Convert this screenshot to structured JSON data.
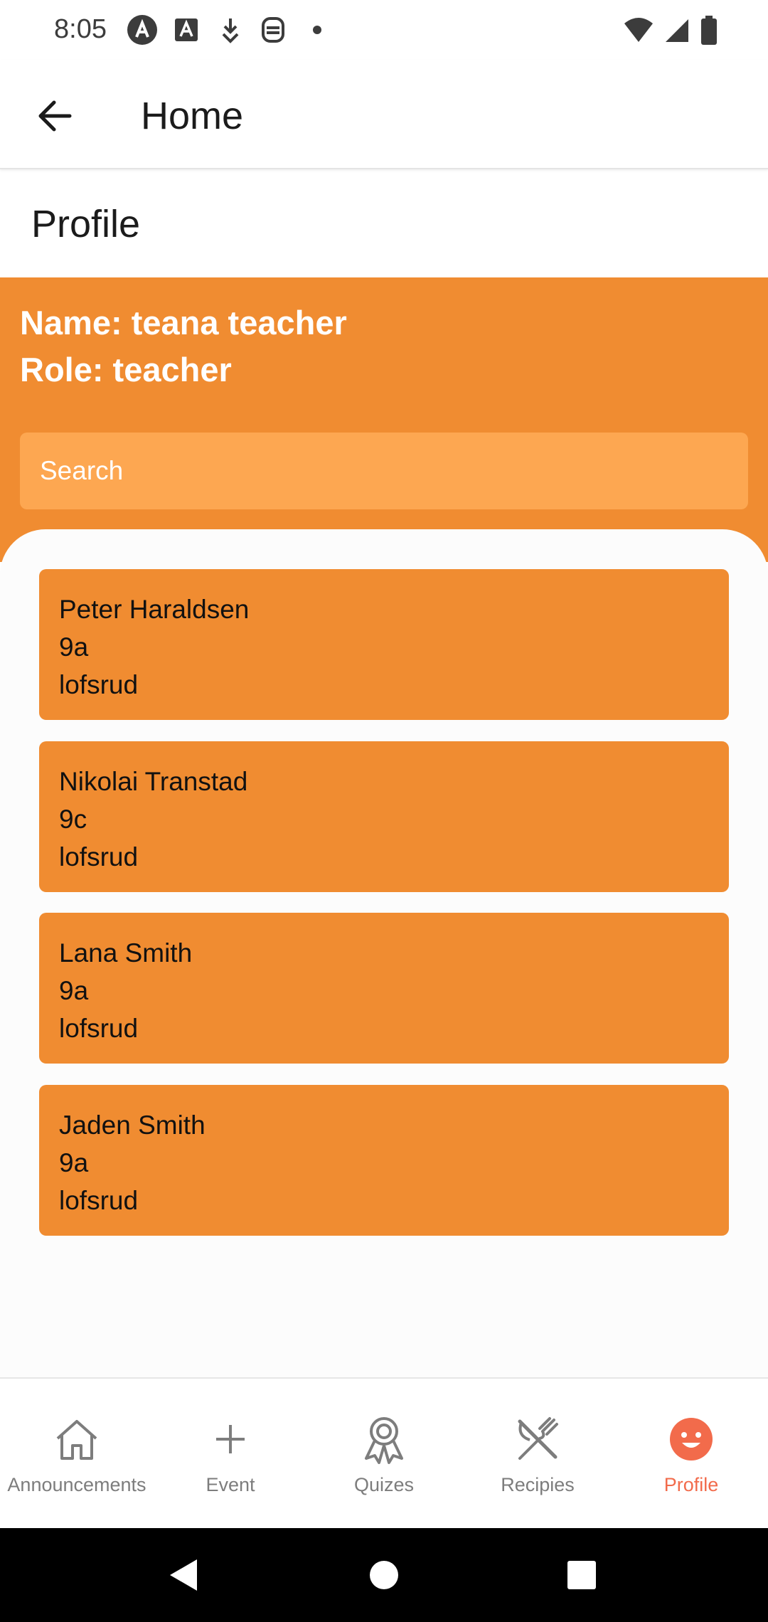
{
  "status_bar": {
    "time": "8:05",
    "left_icons": [
      "a11y-icon",
      "font-icon",
      "download-icon",
      "app-icon",
      "dot-icon"
    ],
    "right_icons": [
      "wifi-icon",
      "signal-icon",
      "battery-icon"
    ]
  },
  "app_bar": {
    "title": "Home",
    "back_icon": "arrow-back-icon"
  },
  "section": {
    "title": "Profile"
  },
  "profile": {
    "name_line": "Name: teana teacher",
    "role_line": "Role: teacher"
  },
  "search": {
    "placeholder": "Search",
    "value": ""
  },
  "students": [
    {
      "name": "Peter Haraldsen",
      "class": "9a",
      "school": "lofsrud"
    },
    {
      "name": "Nikolai Transtad",
      "class": "9c",
      "school": "lofsrud"
    },
    {
      "name": "Lana Smith",
      "class": "9a",
      "school": "lofsrud"
    },
    {
      "name": "Jaden Smith",
      "class": "9a",
      "school": "lofsrud"
    }
  ],
  "bottom_nav": {
    "items": [
      {
        "label": "Announcements",
        "icon": "home-icon",
        "active": false
      },
      {
        "label": "Event",
        "icon": "plus-icon",
        "active": false
      },
      {
        "label": "Quizes",
        "icon": "award-icon",
        "active": false
      },
      {
        "label": "Recipies",
        "icon": "utensils-icon",
        "active": false
      },
      {
        "label": "Profile",
        "icon": "smiley-icon",
        "active": true
      }
    ]
  },
  "colors": {
    "accent_orange": "#F08C31",
    "search_orange": "#FDA751",
    "active_nav": "#F26B4B",
    "inactive_nav": "#7d7d7d"
  }
}
